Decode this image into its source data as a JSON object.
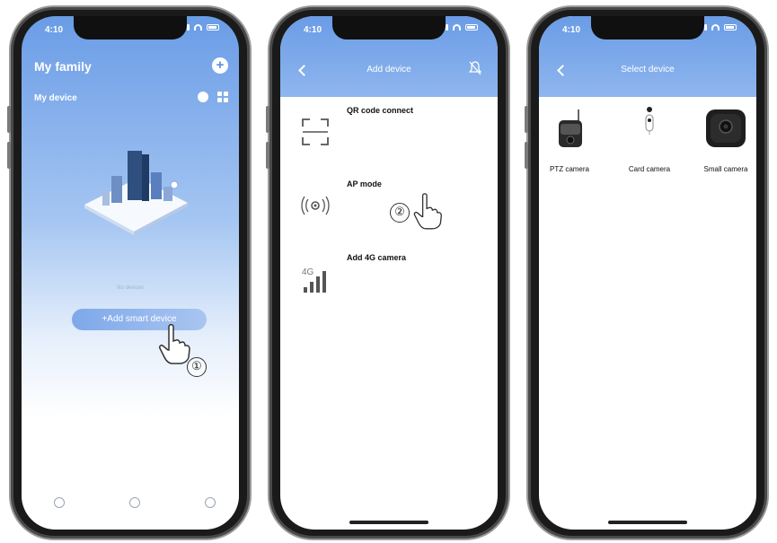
{
  "phone1": {
    "status_time": "4:10",
    "title": "My family",
    "subtitle": "My device",
    "plus_icon": "plus-circle-icon",
    "caption": "No devices",
    "add_button": "+Add smart device",
    "step": "①"
  },
  "phone2": {
    "status_time": "4:10",
    "header_title": "Add device",
    "items": [
      {
        "title": "QR code connect",
        "desc": "",
        "icon": "qr-scan-icon"
      },
      {
        "title": "AP mode",
        "desc": "",
        "icon": "ap-signal-icon"
      },
      {
        "title": "Add 4G camera",
        "desc": "",
        "icon": "4g-signal-icon"
      }
    ],
    "step": "②"
  },
  "phone3": {
    "status_time": "4:10",
    "header_title": "Select device",
    "devices": [
      {
        "label": "PTZ camera",
        "icon": "ptz-camera-icon"
      },
      {
        "label": "Card camera",
        "icon": "card-camera-icon"
      },
      {
        "label": "Small camera",
        "icon": "small-camera-icon"
      }
    ]
  },
  "colors": {
    "accent": "#6a9ce6",
    "text": "#111111"
  }
}
